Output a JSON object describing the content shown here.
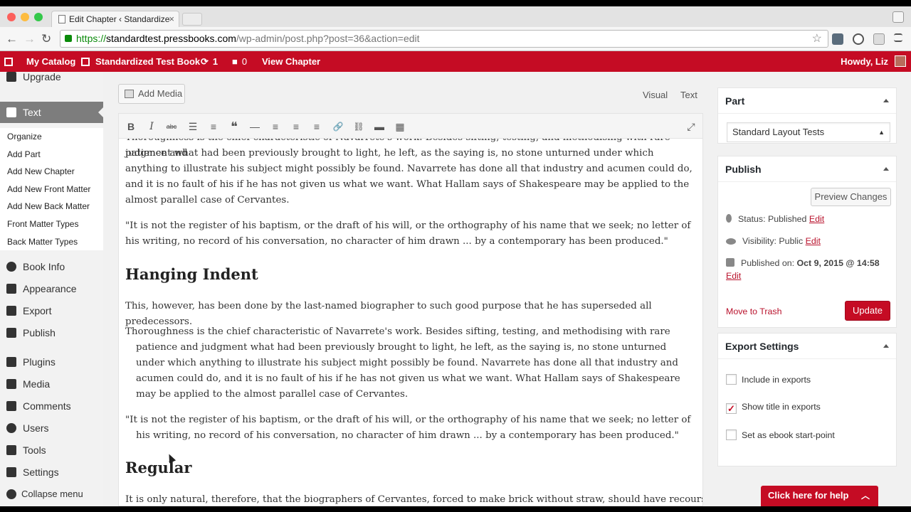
{
  "browser": {
    "tab_title": "Edit Chapter ‹ Standardize",
    "tab_close": "×",
    "url_scheme": "https://",
    "url_host": "standardtest.pressbooks.com",
    "url_path": "/wp-admin/post.php?post=36&action=edit",
    "back": "←",
    "forward": "→",
    "reload": "↻",
    "star": "☆"
  },
  "adminbar": {
    "my_catalog": "My Catalog",
    "book": "Standardized Test Book",
    "updates_count": "1",
    "comments_count": "0",
    "view_chapter": "View Chapter",
    "howdy": "Howdy, Liz"
  },
  "sidebar": {
    "upgrade": "Upgrade",
    "text": "Text",
    "submenu": [
      "Organize",
      "Add Part",
      "Add New Chapter",
      "Add New Front Matter",
      "Add New Back Matter",
      "Front Matter Types",
      "Back Matter Types"
    ],
    "items": [
      "Book Info",
      "Appearance",
      "Export",
      "Publish",
      "Plugins",
      "Media",
      "Comments",
      "Users",
      "Tools",
      "Settings"
    ],
    "collapse": "Collapse menu"
  },
  "editor": {
    "add_media": "Add Media",
    "tab_visual": "Visual",
    "tab_text": "Text",
    "toolbar": [
      "B",
      "I",
      "abc",
      "☰",
      "≡",
      "❝",
      "—",
      "≡",
      "≡",
      "≡",
      "🔗",
      "⛓",
      "▬",
      "▦"
    ],
    "fullscreen": "⤢",
    "top_partial": "Thoroughness is the chief characteristic of Navarrete's work. Besides sifting, testing, and methodising with rare patience and",
    "para1_rest": "judgment what had been previously brought to light, he left, as the saying is, no stone unturned under which anything to illustrate his subject might possibly be found. Navarrete has done all that industry and acumen could do, and it is no fault of his if he has not given us what we want. What Hallam says of Shakespeare may be applied to the almost parallel case of Cervantes.",
    "quote1": "\"It is not the register of his baptism, or the draft of his will, or the orthography of his name that we seek; no letter of his writing, no record of his conversation, no character of him drawn ... by a contemporary has been produced.\"",
    "heading_hanging": "Hanging Indent",
    "hanging_intro": "This, however, has been done by the last-named biographer to such good purpose that he has superseded all predecessors.",
    "hanging_para": "Thoroughness is the chief characteristic of Navarrete's work. Besides sifting, testing, and methodising with rare patience and judgment what had been previously brought to light, he left, as the saying is, no stone unturned under which anything to illustrate his subject might possibly be found. Navarrete has done all that industry and acumen could do, and it is no fault of his if he has not given us what we want. What Hallam says of Shakespeare may be applied to the almost parallel case of Cervantes.",
    "hanging_quote": "\"It is not the register of his baptism, or the draft of his will, or the orthography of his name that we seek; no letter of his writing, no record of his conversation, no character of him drawn ... by a contemporary has been produced.\"",
    "heading_regular": "Regular",
    "regular_para": "It is only natural, therefore, that the biographers of Cervantes, forced to make brick without straw, should have recourse"
  },
  "part_box": {
    "title": "Part",
    "selected": "Standard Layout Tests"
  },
  "publish_box": {
    "title": "Publish",
    "preview": "Preview Changes",
    "status_label": "Status: ",
    "status_value": "Published",
    "visibility_label": "Visibility: ",
    "visibility_value": "Public",
    "published_label": "Published on: ",
    "published_value": "Oct 9, 2015 @ 14:58",
    "edit": "Edit",
    "trash": "Move to Trash",
    "update": "Update"
  },
  "export_box": {
    "title": "Export Settings",
    "include": "Include in exports",
    "show_title": "Show title in exports",
    "start_point": "Set as ebook start-point",
    "checked_mark": "✓"
  },
  "help": {
    "label": "Click here for help",
    "arrow": "︿"
  },
  "colors": {
    "brand": "#c50c24",
    "sidebar_current": "#7d7d7d"
  }
}
